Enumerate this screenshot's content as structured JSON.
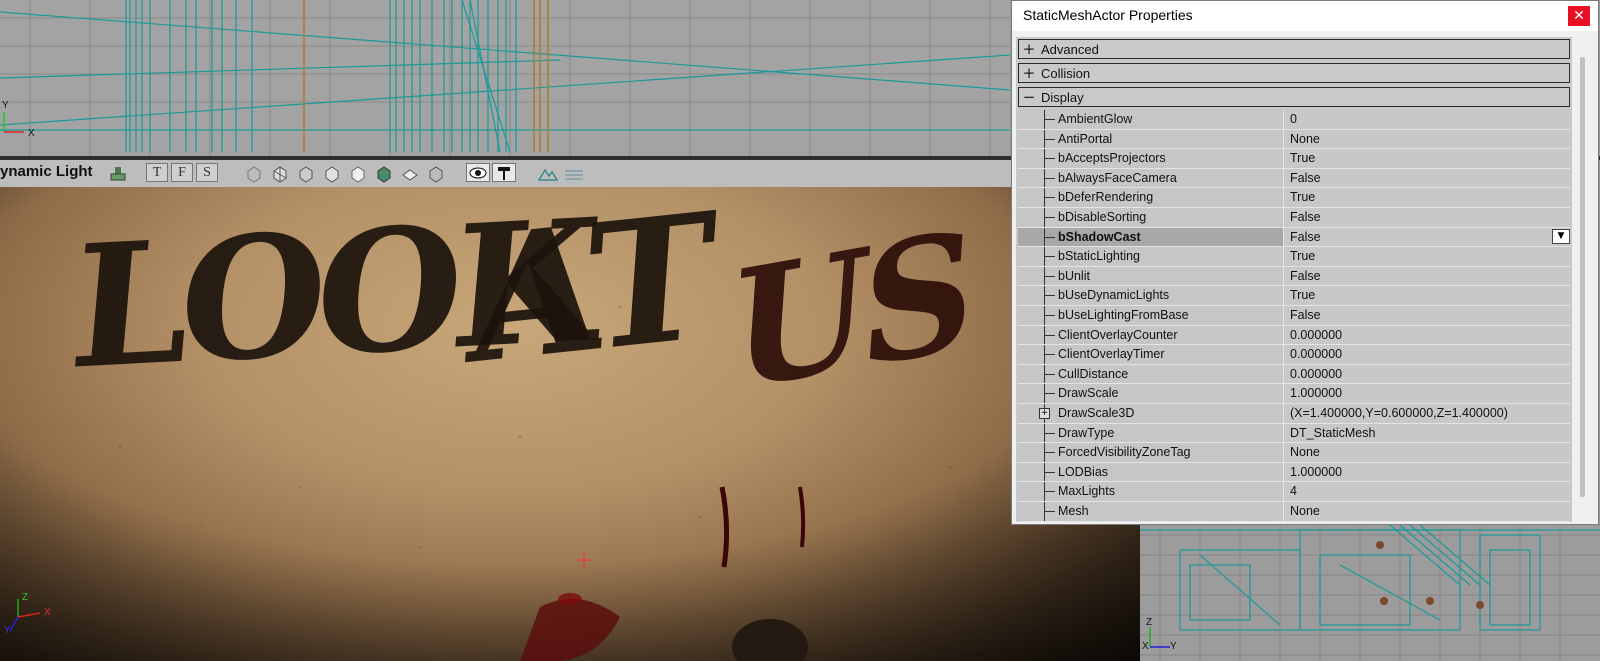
{
  "window": {
    "title": "StaticMeshActor Properties",
    "close_glyph": "✕"
  },
  "viewport": {
    "title": "ynamic Light",
    "tool_letters": [
      "T",
      "F",
      "S"
    ],
    "top_axis_y": "Y",
    "top_axis_x": "X",
    "bottom_axis_z": "Z",
    "bottom_axis_x": "X",
    "bottom_axis_y": "Y",
    "br_axis_z": "Z",
    "br_axis_x": "X",
    "br_axis_y": "Y"
  },
  "categories": [
    {
      "sign": "+",
      "label": "Advanced"
    },
    {
      "sign": "+",
      "label": "Collision"
    },
    {
      "sign": "−",
      "label": "Display"
    }
  ],
  "properties": [
    {
      "name": "AmbientGlow",
      "value": "0"
    },
    {
      "name": "AntiPortal",
      "value": "None"
    },
    {
      "name": "bAcceptsProjectors",
      "value": "True"
    },
    {
      "name": "bAlwaysFaceCamera",
      "value": "False"
    },
    {
      "name": "bDeferRendering",
      "value": "True"
    },
    {
      "name": "bDisableSorting",
      "value": "False"
    },
    {
      "name": "bShadowCast",
      "value": "False"
    },
    {
      "name": "bStaticLighting",
      "value": "True"
    },
    {
      "name": "bUnlit",
      "value": "False"
    },
    {
      "name": "bUseDynamicLights",
      "value": "True"
    },
    {
      "name": "bUseLightingFromBase",
      "value": "False"
    },
    {
      "name": "ClientOverlayCounter",
      "value": "0.000000"
    },
    {
      "name": "ClientOverlayTimer",
      "value": "0.000000"
    },
    {
      "name": "CullDistance",
      "value": "0.000000"
    },
    {
      "name": "DrawScale",
      "value": "1.000000"
    },
    {
      "name": "DrawScale3D",
      "value": "(X=1.400000,Y=0.600000,Z=1.400000)"
    },
    {
      "name": "DrawType",
      "value": "DT_StaticMesh"
    },
    {
      "name": "ForcedVisibilityZoneTag",
      "value": "None"
    },
    {
      "name": "LODBias",
      "value": "1.000000"
    },
    {
      "name": "MaxLights",
      "value": "4"
    },
    {
      "name": "Mesh",
      "value": "None"
    }
  ],
  "selected_property": "bShadowCast",
  "expandable_property": "DrawScale3D",
  "expander_glyph": "+",
  "dropdown_glyph": "▼",
  "scene": {
    "graffiti": [
      "LOOK",
      "AT",
      "US"
    ]
  }
}
